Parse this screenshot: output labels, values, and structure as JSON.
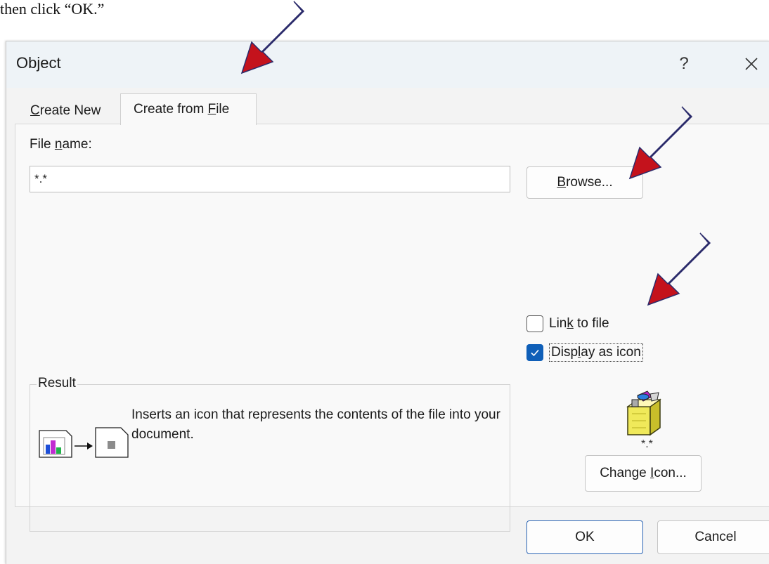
{
  "caption": "then click “OK.”",
  "dialog": {
    "title": "Object",
    "help_glyph": "?",
    "close_glyph": "✕"
  },
  "tabs": [
    {
      "label_pre": "",
      "label_mnemonic": "C",
      "label_post": "reate New",
      "active": false
    },
    {
      "label_pre": "Create from ",
      "label_mnemonic": "F",
      "label_post": "ile",
      "active": true
    }
  ],
  "file_name": {
    "label_pre": "File ",
    "label_mnemonic": "n",
    "label_post": "ame:",
    "value": "*.*"
  },
  "browse_button": {
    "label_pre": "",
    "label_mnemonic": "B",
    "label_post": "rowse..."
  },
  "link_to_file": {
    "label_pre": "Lin",
    "label_mnemonic": "k",
    "label_post": " to file",
    "checked": false
  },
  "display_as_icon": {
    "label_pre": "Disp",
    "label_mnemonic": "l",
    "label_post": "ay as icon",
    "checked": true
  },
  "result": {
    "legend": "Result",
    "text": "Inserts an icon that represents the contents of the file into your document."
  },
  "icon_preview": {
    "label": "*.*"
  },
  "change_icon_button": {
    "label_pre": "Change ",
    "label_mnemonic": "I",
    "label_post": "con..."
  },
  "ok_button": {
    "label": "OK"
  },
  "cancel_button": {
    "label": "Cancel"
  },
  "colors": {
    "accent": "#0f5fb8",
    "annotation_arrow": "#c4121c"
  }
}
